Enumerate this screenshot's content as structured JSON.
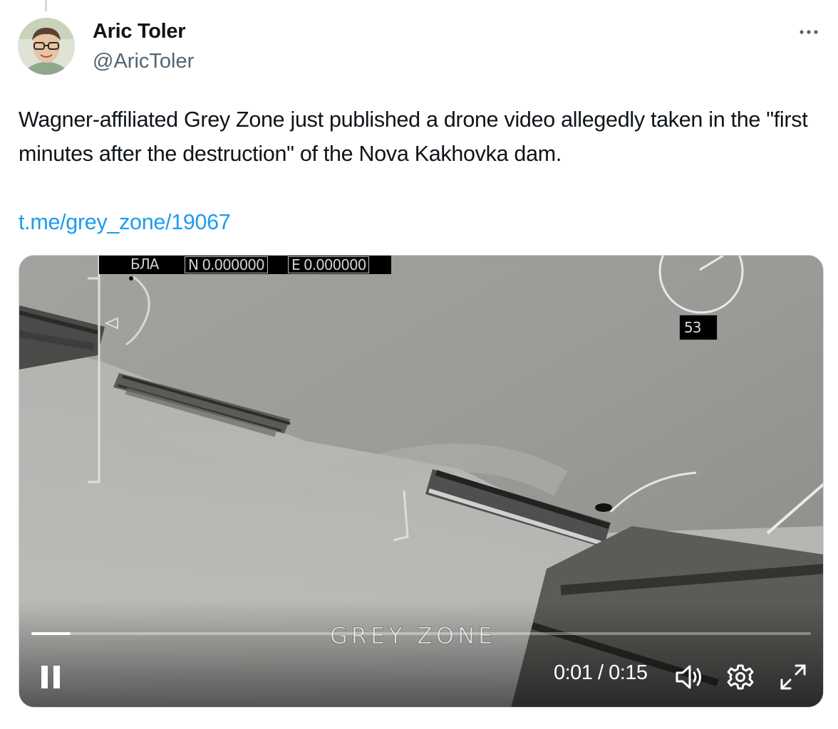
{
  "tweet": {
    "author": {
      "name": "Aric Toler",
      "handle": "@AricToler"
    },
    "text": "Wagner-affiliated Grey Zone just published a drone video allegedly taken in the \"first minutes after the destruction\" of the Nova Kakhovka dam.",
    "link": "t.me/grey_zone/19067",
    "more_icon": "more-dots-icon"
  },
  "video": {
    "hud": {
      "label": "БЛА",
      "north": "N 0.000000",
      "east": "E 0.000000",
      "heading_value": "53"
    },
    "watermark": "GREY ZONE",
    "player": {
      "time_display": "0:01 / 0:15",
      "progress": 0.05,
      "state": "playing",
      "icons": [
        "pause-icon",
        "volume-icon",
        "settings-gear-icon",
        "fullscreen-icon"
      ]
    }
  },
  "colors": {
    "link": "#1d9bf0",
    "text": "#0f1419",
    "secondary": "#536471"
  }
}
